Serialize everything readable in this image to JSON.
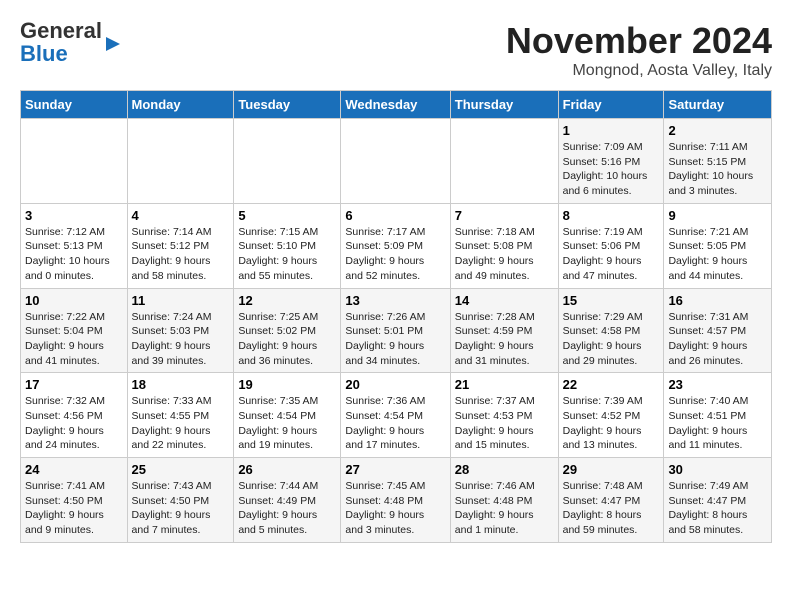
{
  "header": {
    "logo_line1": "General",
    "logo_line2": "Blue",
    "month_title": "November 2024",
    "location": "Mongnod, Aosta Valley, Italy"
  },
  "weekdays": [
    "Sunday",
    "Monday",
    "Tuesday",
    "Wednesday",
    "Thursday",
    "Friday",
    "Saturday"
  ],
  "weeks": [
    [
      {
        "day": "",
        "info": ""
      },
      {
        "day": "",
        "info": ""
      },
      {
        "day": "",
        "info": ""
      },
      {
        "day": "",
        "info": ""
      },
      {
        "day": "",
        "info": ""
      },
      {
        "day": "1",
        "info": "Sunrise: 7:09 AM\nSunset: 5:16 PM\nDaylight: 10 hours\nand 6 minutes."
      },
      {
        "day": "2",
        "info": "Sunrise: 7:11 AM\nSunset: 5:15 PM\nDaylight: 10 hours\nand 3 minutes."
      }
    ],
    [
      {
        "day": "3",
        "info": "Sunrise: 7:12 AM\nSunset: 5:13 PM\nDaylight: 10 hours\nand 0 minutes."
      },
      {
        "day": "4",
        "info": "Sunrise: 7:14 AM\nSunset: 5:12 PM\nDaylight: 9 hours\nand 58 minutes."
      },
      {
        "day": "5",
        "info": "Sunrise: 7:15 AM\nSunset: 5:10 PM\nDaylight: 9 hours\nand 55 minutes."
      },
      {
        "day": "6",
        "info": "Sunrise: 7:17 AM\nSunset: 5:09 PM\nDaylight: 9 hours\nand 52 minutes."
      },
      {
        "day": "7",
        "info": "Sunrise: 7:18 AM\nSunset: 5:08 PM\nDaylight: 9 hours\nand 49 minutes."
      },
      {
        "day": "8",
        "info": "Sunrise: 7:19 AM\nSunset: 5:06 PM\nDaylight: 9 hours\nand 47 minutes."
      },
      {
        "day": "9",
        "info": "Sunrise: 7:21 AM\nSunset: 5:05 PM\nDaylight: 9 hours\nand 44 minutes."
      }
    ],
    [
      {
        "day": "10",
        "info": "Sunrise: 7:22 AM\nSunset: 5:04 PM\nDaylight: 9 hours\nand 41 minutes."
      },
      {
        "day": "11",
        "info": "Sunrise: 7:24 AM\nSunset: 5:03 PM\nDaylight: 9 hours\nand 39 minutes."
      },
      {
        "day": "12",
        "info": "Sunrise: 7:25 AM\nSunset: 5:02 PM\nDaylight: 9 hours\nand 36 minutes."
      },
      {
        "day": "13",
        "info": "Sunrise: 7:26 AM\nSunset: 5:01 PM\nDaylight: 9 hours\nand 34 minutes."
      },
      {
        "day": "14",
        "info": "Sunrise: 7:28 AM\nSunset: 4:59 PM\nDaylight: 9 hours\nand 31 minutes."
      },
      {
        "day": "15",
        "info": "Sunrise: 7:29 AM\nSunset: 4:58 PM\nDaylight: 9 hours\nand 29 minutes."
      },
      {
        "day": "16",
        "info": "Sunrise: 7:31 AM\nSunset: 4:57 PM\nDaylight: 9 hours\nand 26 minutes."
      }
    ],
    [
      {
        "day": "17",
        "info": "Sunrise: 7:32 AM\nSunset: 4:56 PM\nDaylight: 9 hours\nand 24 minutes."
      },
      {
        "day": "18",
        "info": "Sunrise: 7:33 AM\nSunset: 4:55 PM\nDaylight: 9 hours\nand 22 minutes."
      },
      {
        "day": "19",
        "info": "Sunrise: 7:35 AM\nSunset: 4:54 PM\nDaylight: 9 hours\nand 19 minutes."
      },
      {
        "day": "20",
        "info": "Sunrise: 7:36 AM\nSunset: 4:54 PM\nDaylight: 9 hours\nand 17 minutes."
      },
      {
        "day": "21",
        "info": "Sunrise: 7:37 AM\nSunset: 4:53 PM\nDaylight: 9 hours\nand 15 minutes."
      },
      {
        "day": "22",
        "info": "Sunrise: 7:39 AM\nSunset: 4:52 PM\nDaylight: 9 hours\nand 13 minutes."
      },
      {
        "day": "23",
        "info": "Sunrise: 7:40 AM\nSunset: 4:51 PM\nDaylight: 9 hours\nand 11 minutes."
      }
    ],
    [
      {
        "day": "24",
        "info": "Sunrise: 7:41 AM\nSunset: 4:50 PM\nDaylight: 9 hours\nand 9 minutes."
      },
      {
        "day": "25",
        "info": "Sunrise: 7:43 AM\nSunset: 4:50 PM\nDaylight: 9 hours\nand 7 minutes."
      },
      {
        "day": "26",
        "info": "Sunrise: 7:44 AM\nSunset: 4:49 PM\nDaylight: 9 hours\nand 5 minutes."
      },
      {
        "day": "27",
        "info": "Sunrise: 7:45 AM\nSunset: 4:48 PM\nDaylight: 9 hours\nand 3 minutes."
      },
      {
        "day": "28",
        "info": "Sunrise: 7:46 AM\nSunset: 4:48 PM\nDaylight: 9 hours\nand 1 minute."
      },
      {
        "day": "29",
        "info": "Sunrise: 7:48 AM\nSunset: 4:47 PM\nDaylight: 8 hours\nand 59 minutes."
      },
      {
        "day": "30",
        "info": "Sunrise: 7:49 AM\nSunset: 4:47 PM\nDaylight: 8 hours\nand 58 minutes."
      }
    ]
  ]
}
